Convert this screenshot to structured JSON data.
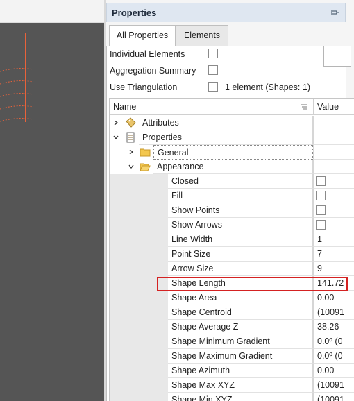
{
  "panel": {
    "title": "Properties",
    "tabs": [
      {
        "label": "All Properties",
        "active": true
      },
      {
        "label": "Elements",
        "active": false
      }
    ],
    "options": [
      {
        "label": "Individual Elements",
        "checked": false
      },
      {
        "label": "Aggregation Summary",
        "checked": false
      },
      {
        "label": "Use Triangulation",
        "checked": false
      }
    ],
    "selection_info": "1 element (Shapes: 1)"
  },
  "grid": {
    "header": {
      "name": "Name",
      "value": "Value"
    },
    "tree": [
      {
        "label": "Attributes",
        "level": 0,
        "expanded": false,
        "icon": "tag-icon"
      },
      {
        "label": "Properties",
        "level": 0,
        "expanded": true,
        "icon": "list-icon"
      },
      {
        "label": "General",
        "level": 1,
        "expanded": false,
        "icon": "folder-icon"
      },
      {
        "label": "Appearance",
        "level": 1,
        "expanded": true,
        "icon": "folder-open-icon"
      }
    ],
    "properties": [
      {
        "label": "Closed",
        "value": "",
        "checkbox": true
      },
      {
        "label": "Fill",
        "value": "",
        "checkbox": true
      },
      {
        "label": "Show Points",
        "value": "",
        "checkbox": true
      },
      {
        "label": "Show Arrows",
        "value": "",
        "checkbox": true
      },
      {
        "label": "Line Width",
        "value": "1"
      },
      {
        "label": "Point Size",
        "value": "7"
      },
      {
        "label": "Arrow Size",
        "value": "9"
      },
      {
        "label": "Shape Length",
        "value": "141.72",
        "highlighted": true
      },
      {
        "label": "Shape Area",
        "value": "0.00"
      },
      {
        "label": "Shape Centroid",
        "value": "(10091"
      },
      {
        "label": "Shape Average Z",
        "value": "38.26"
      },
      {
        "label": "Shape Minimum Gradient",
        "value": "0.0º (0"
      },
      {
        "label": "Shape Maximum Gradient",
        "value": "0.0º (0"
      },
      {
        "label": "Shape Azimuth",
        "value": "0.00"
      },
      {
        "label": "Shape Max XYZ",
        "value": "(10091"
      },
      {
        "label": "Shape Min XYZ",
        "value": "(10091"
      }
    ]
  },
  "colors": {
    "viewport": "#555555",
    "shape_line": "#e8623a",
    "highlight": "#d42222",
    "header_bg": "#dfe7f1"
  }
}
